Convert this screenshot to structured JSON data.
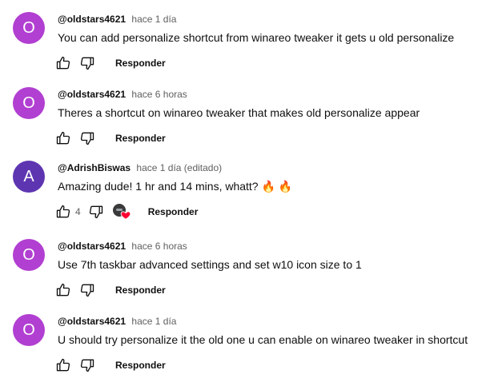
{
  "colors": {
    "avatar_o": "#b13fd1",
    "avatar_a": "#5e35b1",
    "heart": "#ff0033"
  },
  "comments": [
    {
      "avatar_letter": "O",
      "author": "@oldstars4621",
      "time": "hace 1 día",
      "text": "You can add personalize shortcut from winareo tweaker it gets u old personalize",
      "reply_label": "Responder"
    },
    {
      "avatar_letter": "O",
      "author": "@oldstars4621",
      "time": "hace 6 horas",
      "text": "Theres a shortcut on winareo tweaker that makes old personalize appear",
      "reply_label": "Responder"
    },
    {
      "avatar_letter": "A",
      "author": "@AdrishBiswas",
      "time": "hace 1 día (editado)",
      "text": "Amazing dude! 1 hr and 14 mins, whatt? 🔥 🔥",
      "like_count": "4",
      "reply_label": "Responder"
    },
    {
      "avatar_letter": "O",
      "author": "@oldstars4621",
      "time": "hace 6 horas",
      "text": "Use 7th taskbar advanced settings and set w10 icon size to 1",
      "reply_label": "Responder"
    },
    {
      "avatar_letter": "O",
      "author": "@oldstars4621",
      "time": "hace 1 día",
      "text": "U should try personalize it the old one u can enable on winareo tweaker in shortcut",
      "reply_label": "Responder"
    }
  ]
}
